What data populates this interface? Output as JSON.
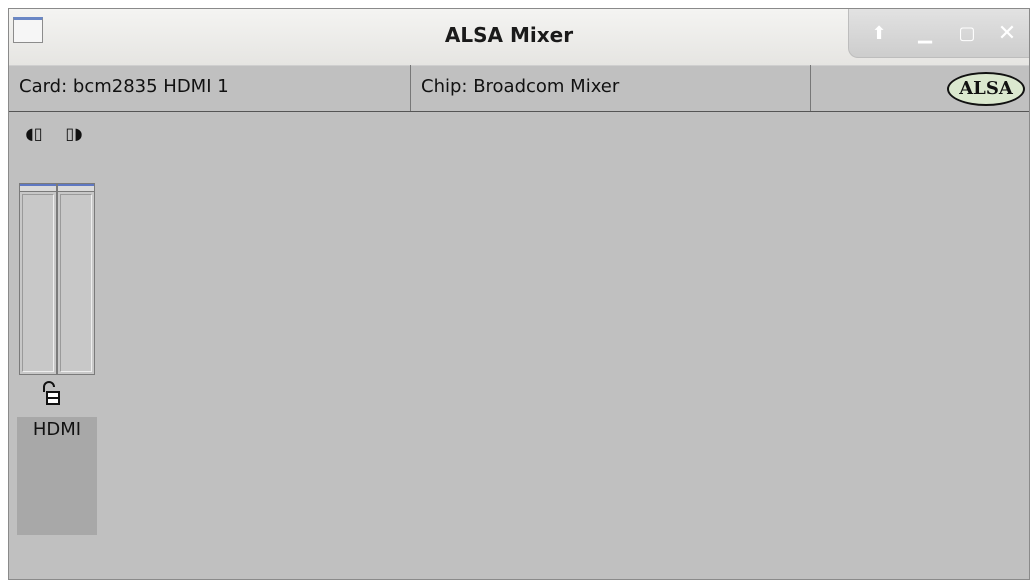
{
  "window": {
    "title": "ALSA Mixer",
    "controls": {
      "up_icon": "arrow-up-icon",
      "minimize_icon": "minimize-icon",
      "maximize_icon": "maximize-icon",
      "close_icon": "close-icon"
    }
  },
  "info": {
    "card": "Card: bcm2835 HDMI 1",
    "chip": "Chip: Broadcom Mixer",
    "logo": "ALSA"
  },
  "channel": {
    "name": "HDMI",
    "left_icon": "speaker-left-icon",
    "right_icon": "speaker-right-icon",
    "lock_icon": "lock-icon"
  },
  "colors": {
    "background": "#c0c0c0",
    "accent": "#5f78c2",
    "logo_fill": "#dbe8cf"
  }
}
